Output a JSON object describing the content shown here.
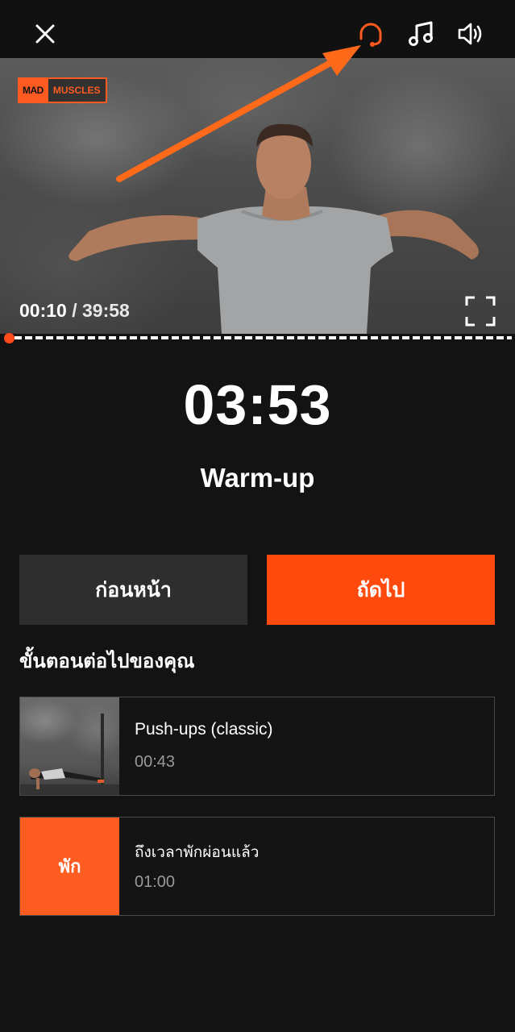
{
  "topbar": {
    "close_icon": "close-icon",
    "headset_icon": "headset-icon",
    "music_icon": "music-note-icon",
    "volume_icon": "volume-icon",
    "accent_color": "#ff5a1f"
  },
  "video": {
    "logo_part1": "MAD",
    "logo_part2": "MUSCLES",
    "current_time": "00:10",
    "separator": " / ",
    "total_time": "39:58",
    "progress_fraction": 0.004
  },
  "workout": {
    "countdown": "03:53",
    "title": "Warm-up"
  },
  "controls": {
    "prev_label": "ก่อนหน้า",
    "next_label": "ถัดไป"
  },
  "next_steps": {
    "heading": "ขั้นตอนต่อไปของคุณ",
    "items": [
      {
        "name": "Push-ups (classic)",
        "duration": "00:43"
      },
      {
        "badge": "พัก",
        "name": "ถึงเวลาพักผ่อนแล้ว",
        "duration": "01:00"
      }
    ]
  }
}
